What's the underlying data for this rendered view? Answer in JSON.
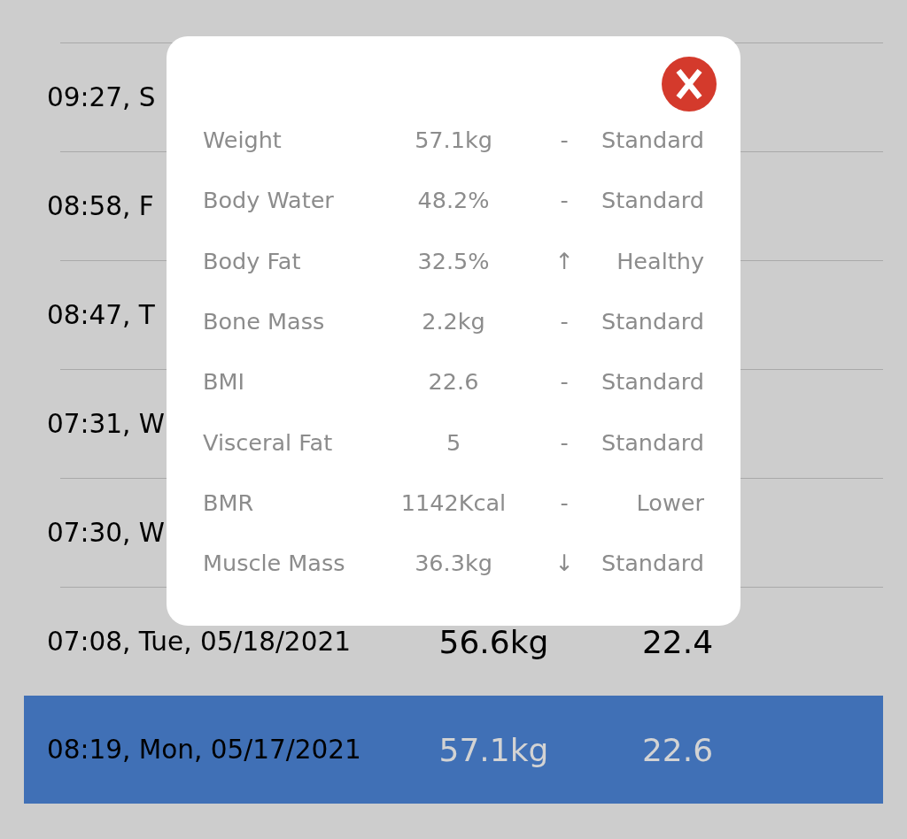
{
  "history": {
    "rows": [
      {
        "time": "09:27, S",
        "selected": false
      },
      {
        "time": "08:58, F",
        "selected": false
      },
      {
        "time": "08:47, T",
        "selected": false
      },
      {
        "time": "07:31, W",
        "selected": false
      },
      {
        "time": "07:30, W",
        "selected": false
      },
      {
        "time": "07:08, Tue, 05/18/2021",
        "weight": "56.6kg",
        "bmi": "22.4",
        "selected": false
      },
      {
        "time": "08:19, Mon, 05/17/2021",
        "weight": "57.1kg",
        "bmi": "22.6",
        "selected": true
      }
    ]
  },
  "detail_dialog": {
    "metrics": [
      {
        "name": "Weight",
        "value": "57.1kg",
        "trend": "-",
        "status": "Standard"
      },
      {
        "name": "Body Water",
        "value": "48.2%",
        "trend": "-",
        "status": "Standard"
      },
      {
        "name": "Body Fat",
        "value": "32.5%",
        "trend": "↑",
        "status": "Healthy"
      },
      {
        "name": "Bone Mass",
        "value": "2.2kg",
        "trend": "-",
        "status": "Standard"
      },
      {
        "name": "BMI",
        "value": "22.6",
        "trend": "-",
        "status": "Standard"
      },
      {
        "name": "Visceral Fat",
        "value": "5",
        "trend": "-",
        "status": "Standard"
      },
      {
        "name": "BMR",
        "value": "1142Kcal",
        "trend": "-",
        "status": "Lower"
      },
      {
        "name": "Muscle Mass",
        "value": "36.3kg",
        "trend": "↓",
        "status": "Standard"
      }
    ]
  }
}
